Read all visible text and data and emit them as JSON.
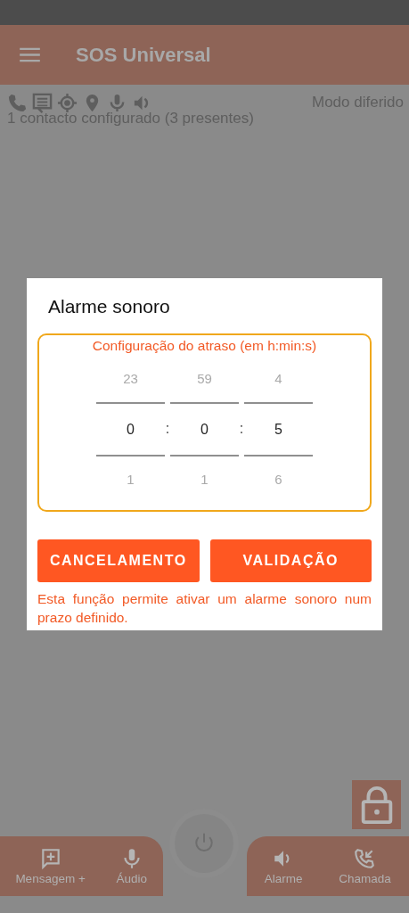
{
  "app_bar": {
    "title": "SOS Universal"
  },
  "status": {
    "mode": "Modo diferido",
    "contacts": "1 contacto configurado (3 presentes)"
  },
  "dialog": {
    "title": "Alarme sonoro",
    "picker_label": "Configuração do atraso (em h:min:s)",
    "columns": [
      {
        "above": "23",
        "value": "0",
        "below": "1"
      },
      {
        "above": "59",
        "value": "0",
        "below": "1"
      },
      {
        "above": "4",
        "value": "5",
        "below": "6"
      }
    ],
    "separators": [
      ":",
      ":"
    ],
    "buttons": [
      "CANCELAMENTO",
      "VALIDAÇÃO"
    ],
    "description": "Esta função permite ativar um alarme sonoro num prazo definido."
  },
  "bottom_nav": [
    {
      "kind": "message",
      "label": "Mensagem +"
    },
    {
      "kind": "mic",
      "label": "Áudio"
    },
    {
      "kind": "speaker",
      "label": "Alarme"
    },
    {
      "kind": "call",
      "label": "Chamada"
    }
  ]
}
